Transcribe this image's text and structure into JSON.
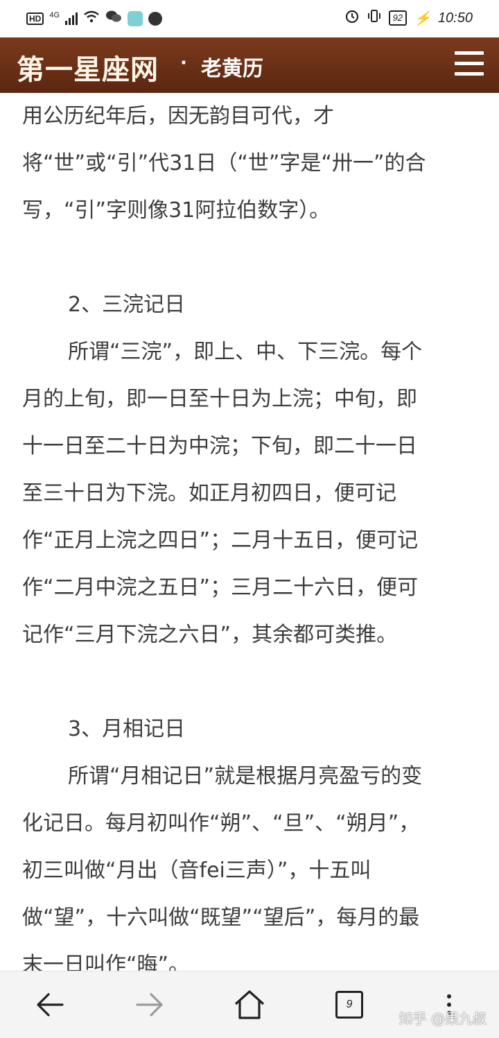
{
  "status_bar": {
    "hd": "HD",
    "network": "4G",
    "time": "10:50",
    "battery": "92"
  },
  "header": {
    "site_name": "第一星座网",
    "separator": "·",
    "section": "老黄历"
  },
  "article": {
    "lines": [
      "用公历纪年后，因无韵目可代，才",
      "将“世”或“引”代31日（“世”字是“卅一”的合",
      "写，“引”字则像31阿拉伯数字）。",
      "",
      "2、三浣记日",
      "所谓“三浣”，即上、中、下三浣。每个",
      "月的上旬，即一日至十日为上浣；中旬，即",
      "十一日至二十日为中浣；下旬，即二十一日",
      "至三十日为下浣。如正月初四日，便可记",
      "作“正月上浣之四日”；二月十五日，便可记",
      "作“二月中浣之五日”；三月二十六日，便可",
      "记作“三月下浣之六日”，其余都可类推。",
      "",
      "3、月相记日",
      "所谓“月相记日”就是根据月亮盈亏的变",
      "化记日。每月初叫作“朔”、“旦”、“朔月”，",
      "初三叫做“月出（音fei三声）”，十五叫",
      "做“望”，十六叫做“既望”“望后”，每月的最",
      "末一日叫作“晦”。"
    ]
  },
  "bottom_nav": {
    "tab_count": "9",
    "watermark": "知乎 @果九叔"
  }
}
